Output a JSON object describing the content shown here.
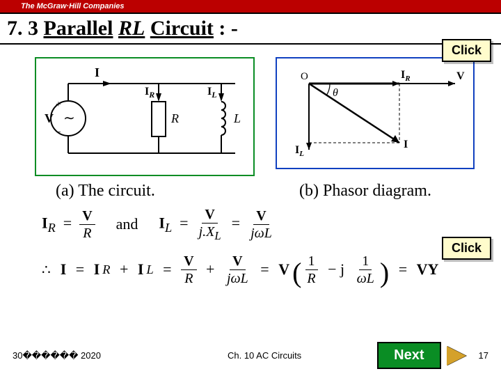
{
  "brand": "The McGraw·Hill Companies",
  "heading": {
    "num": "7. 3",
    "title_pre": "Parallel",
    "title_rl": "RL",
    "title_post": "Circuit",
    "suffix": ": -"
  },
  "buttons": {
    "click1": "Click",
    "click2": "Click",
    "next": "Next"
  },
  "captions": {
    "a": "(a) The circuit.",
    "b": "(b) Phasor diagram."
  },
  "circuit": {
    "I": "I",
    "IR": "I",
    "IR_sub": "R",
    "IL": "I",
    "IL_sub": "L",
    "V": "V",
    "R": "R",
    "L": "L",
    "plus": "+",
    "minus": "−",
    "tilde": "∼"
  },
  "phasor": {
    "O": "O",
    "theta": "θ",
    "IR": "I",
    "IR_sub": "R",
    "IL": "I",
    "IL_sub": "L",
    "I": "I",
    "V": "V"
  },
  "equations": {
    "IR_lhs": "I",
    "IR_sub": "R",
    "eq": "=",
    "V": "V",
    "R": "R",
    "and": "and",
    "IL_lhs": "I",
    "IL_sub": "L",
    "jXL": "j.X",
    "XL_sub": "L",
    "jomegaL": "jωL",
    "therefore": "∴",
    "I": "I",
    "plus": "+",
    "one": "1",
    "minus_j": "− j",
    "omegaL": "ωL",
    "VY": "VY"
  },
  "footer": {
    "date": "30������ 2020",
    "chapter": "Ch. 10 AC Circuits",
    "page": "17"
  }
}
